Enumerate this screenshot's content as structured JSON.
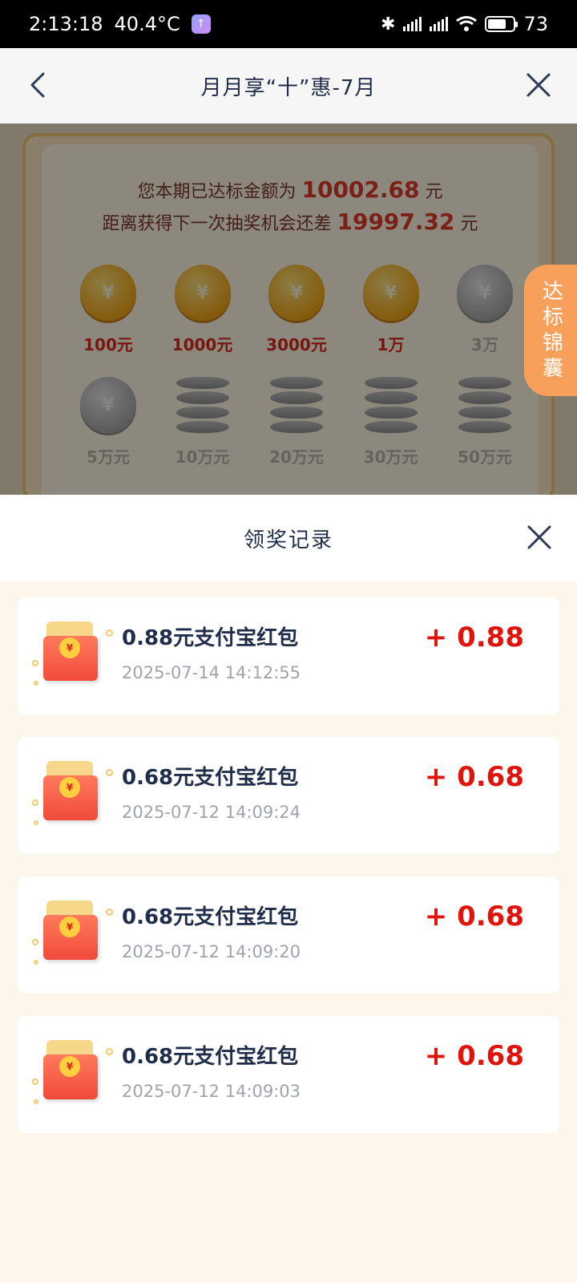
{
  "status_bar": {
    "time": "2:13:18",
    "temperature": "40.4°C",
    "battery": "73",
    "battery_level": 0.73
  },
  "title_bar": {
    "title": "月月享“十”惠-7月"
  },
  "background": {
    "line1_prefix": "您本期已达标金额为",
    "line1_amount": "10002.68",
    "line1_suffix": "元",
    "line2_prefix": "距离获得下一次抽奖机会还差",
    "line2_amount": "19997.32",
    "line2_suffix": "元",
    "milestones_row1": [
      {
        "label": "100元",
        "state": "active"
      },
      {
        "label": "1000元",
        "state": "active"
      },
      {
        "label": "3000元",
        "state": "active"
      },
      {
        "label": "1万",
        "state": "active"
      },
      {
        "label": "3万",
        "state": "inactive"
      }
    ],
    "milestones_row2": [
      {
        "label": "5万元",
        "state": "inactive"
      },
      {
        "label": "10万元",
        "state": "inactive"
      },
      {
        "label": "20万元",
        "state": "inactive"
      },
      {
        "label": "30万元",
        "state": "inactive"
      },
      {
        "label": "50万元",
        "state": "inactive"
      }
    ],
    "side_tab": "达标锦囊"
  },
  "sheet": {
    "title": "领奖记录",
    "records": [
      {
        "title": "0.88元支付宝红包",
        "time": "2025-07-14 14:12:55",
        "amount": "+ 0.88"
      },
      {
        "title": "0.68元支付宝红包",
        "time": "2025-07-12 14:09:24",
        "amount": "+ 0.68"
      },
      {
        "title": "0.68元支付宝红包",
        "time": "2025-07-12 14:09:20",
        "amount": "+ 0.68"
      },
      {
        "title": "0.68元支付宝红包",
        "time": "2025-07-12 14:09:03",
        "amount": "+ 0.68"
      }
    ]
  },
  "colors": {
    "amount_red": "#e0140a",
    "title_navy": "#1f2d4a",
    "sheet_bg": "#fdf6ea",
    "side_tab_orange": "#f7a05c"
  }
}
